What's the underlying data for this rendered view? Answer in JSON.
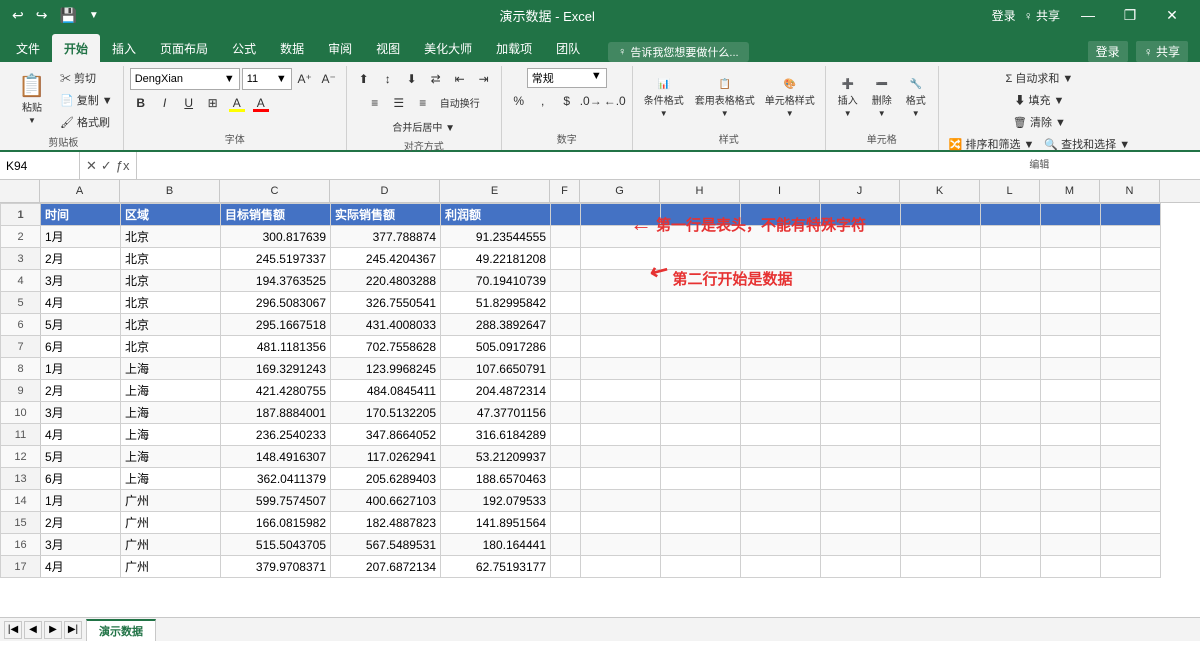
{
  "titleBar": {
    "title": "演示数据 - Excel",
    "controls": [
      "—",
      "❐",
      "✕"
    ]
  },
  "quickAccess": {
    "buttons": [
      "↩",
      "↪",
      "💾",
      "▼"
    ]
  },
  "ribbonTabs": [
    "文件",
    "开始",
    "插入",
    "页面布局",
    "公式",
    "数据",
    "审阅",
    "视图",
    "美化大师",
    "加载项",
    "团队"
  ],
  "activeTab": "开始",
  "searchPlaceholder": "♀ 告诉我您想要做什么...",
  "topRight": [
    "登录",
    "♀ 共享"
  ],
  "ribbon": {
    "groups": [
      {
        "label": "剪贴板",
        "items": [
          "剪切",
          "复制",
          "格式刷"
        ]
      },
      {
        "label": "字体",
        "fontName": "DengXian",
        "fontSize": "11"
      },
      {
        "label": "对齐方式"
      },
      {
        "label": "数字"
      },
      {
        "label": "样式",
        "items": [
          "条件格式",
          "套用表格格式",
          "单元格样式"
        ]
      },
      {
        "label": "单元格",
        "items": [
          "插入",
          "删除",
          "格式"
        ]
      },
      {
        "label": "编辑",
        "items": [
          "自动求和",
          "填充",
          "清除",
          "排序和筛选",
          "查找和选择"
        ]
      }
    ]
  },
  "formulaBar": {
    "cellRef": "K94",
    "formula": ""
  },
  "columns": [
    "A",
    "B",
    "C",
    "D",
    "E",
    "F",
    "G",
    "H",
    "I",
    "J",
    "K",
    "L",
    "M",
    "N"
  ],
  "headers": [
    "时间",
    "区域",
    "目标销售额",
    "实际销售额",
    "利润额"
  ],
  "rows": [
    [
      "1月",
      "北京",
      "300.817639",
      "377.788874",
      "91.23544555"
    ],
    [
      "2月",
      "北京",
      "245.5197337",
      "245.4204367",
      "49.22181208"
    ],
    [
      "3月",
      "北京",
      "194.3763525",
      "220.4803288",
      "70.19410739"
    ],
    [
      "4月",
      "北京",
      "296.5083067",
      "326.7550541",
      "51.82995842"
    ],
    [
      "5月",
      "北京",
      "295.1667518",
      "431.4008033",
      "288.3892647"
    ],
    [
      "6月",
      "北京",
      "481.1181356",
      "702.7558628",
      "505.0917286"
    ],
    [
      "1月",
      "上海",
      "169.3291243",
      "123.9968245",
      "107.6650791"
    ],
    [
      "2月",
      "上海",
      "421.4280755",
      "484.0845411",
      "204.4872314"
    ],
    [
      "3月",
      "上海",
      "187.8884001",
      "170.5132205",
      "47.37701156"
    ],
    [
      "4月",
      "上海",
      "236.2540233",
      "347.8664052",
      "316.6184289"
    ],
    [
      "5月",
      "上海",
      "148.4916307",
      "117.0262941",
      "53.21209937"
    ],
    [
      "6月",
      "上海",
      "362.0411379",
      "205.6289403",
      "188.6570463"
    ],
    [
      "1月",
      "广州",
      "599.7574507",
      "400.6627103",
      "192.079533"
    ],
    [
      "2月",
      "广州",
      "166.0815982",
      "182.4887823",
      "141.8951564"
    ],
    [
      "3月",
      "广州",
      "515.5043705",
      "567.5489531",
      "180.164441"
    ],
    [
      "4月",
      "广州",
      "379.9708371",
      "207.6872134",
      "62.75193177"
    ]
  ],
  "annotations": {
    "text1": "第一行是表头，不能有特殊字符",
    "text2": "第二行开始是数据"
  },
  "sheetTabs": [
    "演示数据"
  ],
  "activeSheet": "演示数据"
}
